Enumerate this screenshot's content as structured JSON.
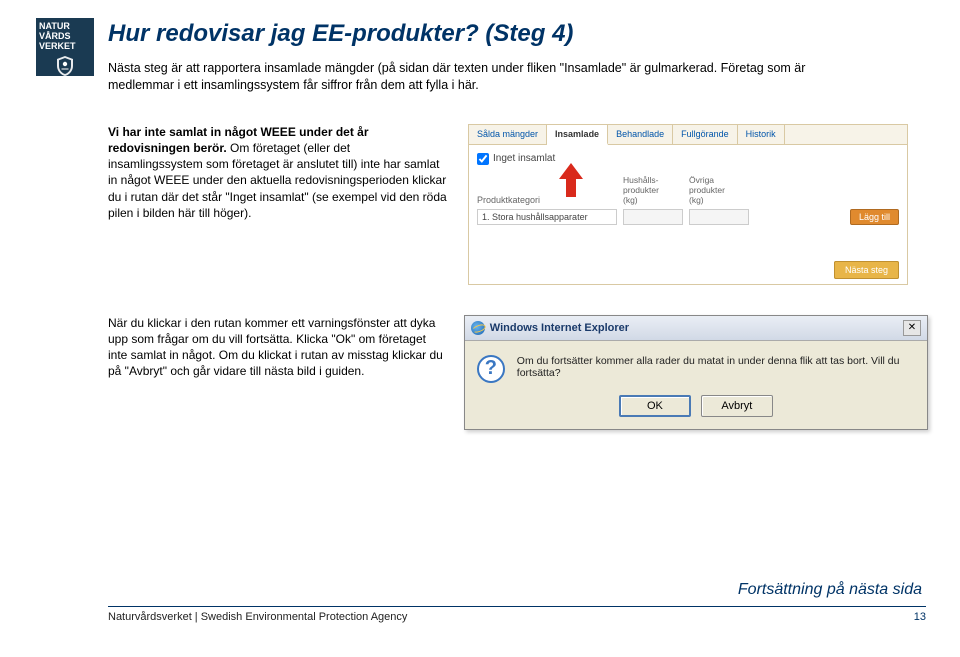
{
  "logo": {
    "line1": "NATUR",
    "line2": "VÅRDS",
    "line3": "VERKET"
  },
  "title": "Hur redovisar jag EE-produkter? (Steg 4)",
  "intro": "Nästa steg är att rapportera insamlade mängder (på sidan där texten under fliken \"Insamlade\" är gulmarkerad. Företag som är medlemmar i ett insamlingssystem får siffror från dem att fylla i här.",
  "section1_bold": "Vi har inte samlat in något WEEE under det år redovisningen berör.",
  "section1_rest": " Om företaget (eller det insamlingssystem som företaget är anslutet till) inte har samlat in något WEEE under den aktuella redovisningsperioden klickar du i rutan där det står \"Inget insamlat\" (se exempel vid den röda pilen i bilden här till höger).",
  "app": {
    "tabs": [
      "Sålda mängder",
      "Insamlade",
      "Behandlade",
      "Fullgörande",
      "Historik"
    ],
    "active_tab_index": 1,
    "checkbox_label": "Inget insamlat",
    "prod_category_label": "Produktkategori",
    "col1": "Hushålls-\nprodukter\n(kg)",
    "col2": "Övriga\nprodukter\n(kg)",
    "row_category": "1. Stora hushållsapparater",
    "add_button": "Lägg till",
    "next_step": "Nästa steg"
  },
  "section2": "När du klickar i den rutan kommer ett varningsfönster att dyka upp som frågar om du vill fortsätta. Klicka \"Ok\" om företaget inte samlat in något. Om du klickat i rutan av misstag klickar du på \"Avbryt\" och går vidare till nästa bild i guiden.",
  "dialog": {
    "title": "Windows Internet Explorer",
    "message": "Om du fortsätter kommer alla rader du matat in under denna flik att tas bort. Vill du fortsätta?",
    "ok": "OK",
    "cancel": "Avbryt",
    "close_glyph": "✕"
  },
  "continuation": "Fortsättning på nästa sida",
  "footer_left": "Naturvårdsverket | Swedish Environmental Protection Agency",
  "footer_page": "13"
}
